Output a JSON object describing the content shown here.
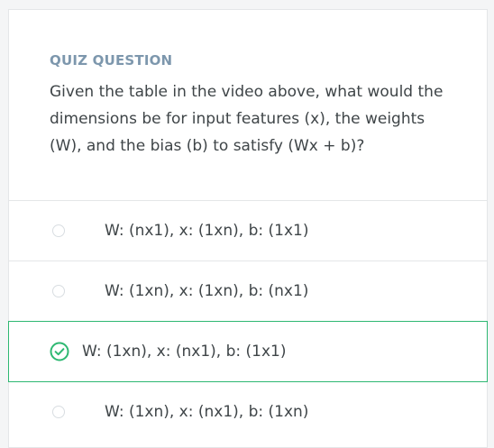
{
  "quiz": {
    "eyebrow": "QUIZ QUESTION",
    "question": "Given the table in the video above, what would the dimensions be for input features (x), the weights (W), and the bias (b) to satisfy (Wx + b)?",
    "options": [
      {
        "label": "W: (nx1), x: (1xn), b: (1x1)",
        "selected": false
      },
      {
        "label": "W: (1xn), x: (1xn), b: (nx1)",
        "selected": false
      },
      {
        "label": "W: (1xn), x: (nx1), b: (1x1)",
        "selected": true
      },
      {
        "label": "W: (1xn), x: (nx1), b: (1xn)",
        "selected": false
      }
    ],
    "colors": {
      "accent": "#2eb872",
      "eyebrow": "#7d97ad",
      "text": "#3f4548",
      "border": "#e4e6e8"
    },
    "icons": {
      "unselected": "radio-empty-icon",
      "selected": "check-circle-icon"
    }
  }
}
